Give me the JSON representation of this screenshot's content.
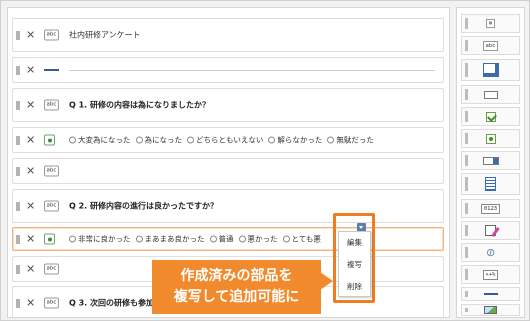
{
  "builder": {
    "rows": [
      {
        "kind": "text",
        "icon": "abc",
        "label": "社内研修アンケート",
        "bold": false
      },
      {
        "kind": "divider",
        "icon": "",
        "label": ""
      },
      {
        "kind": "text",
        "icon": "abc",
        "label": "Q 1. 研修の内容は為になりましたか？",
        "bold": true
      },
      {
        "kind": "radio",
        "options": [
          "大変為になった",
          "為になった",
          "どちらともいえない",
          "解らなかった",
          "無駄だった"
        ]
      },
      {
        "kind": "text",
        "icon": "abc",
        "label": "",
        "bold": false
      },
      {
        "kind": "text",
        "icon": "abc",
        "label": "Q 2. 研修内容の進行は良かったですか？",
        "bold": true
      },
      {
        "kind": "radio",
        "options": [
          "非常に良かった",
          "まあまあ良かった",
          "普通",
          "悪かった",
          "とても悪"
        ]
      },
      {
        "kind": "text",
        "icon": "abc",
        "label": "",
        "bold": false
      },
      {
        "kind": "text",
        "icon": "abc",
        "label": "Q 3. 次回の研修も参加し",
        "bold": true
      }
    ],
    "delete_glyph": "✕"
  },
  "context_menu": {
    "items": [
      "編集",
      "複写",
      "削除"
    ]
  },
  "callout": {
    "line1": "作成済みの部品を",
    "line2": "複写して追加可能に",
    "color": "#f08a2c"
  },
  "palette": {
    "items": [
      {
        "icon": "text-block-icon",
        "text": "abc"
      },
      {
        "icon": "label-icon",
        "text": "abc"
      },
      {
        "icon": "text-input-icon",
        "text": ""
      },
      {
        "icon": "short-input-icon",
        "text": ""
      },
      {
        "icon": "checkbox-icon",
        "text": ""
      },
      {
        "icon": "radio-icon",
        "text": ""
      },
      {
        "icon": "select-icon",
        "text": ""
      },
      {
        "icon": "list-icon",
        "text": ""
      },
      {
        "icon": "number-icon",
        "text": "0123"
      },
      {
        "icon": "edit-icon",
        "text": ""
      },
      {
        "icon": "attachment-icon",
        "text": ""
      },
      {
        "icon": "calc-icon",
        "text": "×+%"
      },
      {
        "icon": "divider-icon",
        "text": ""
      },
      {
        "icon": "image-icon",
        "text": ""
      }
    ]
  },
  "colors": {
    "accent": "#ef7d22",
    "menu_trigger": "#5a7fae"
  }
}
